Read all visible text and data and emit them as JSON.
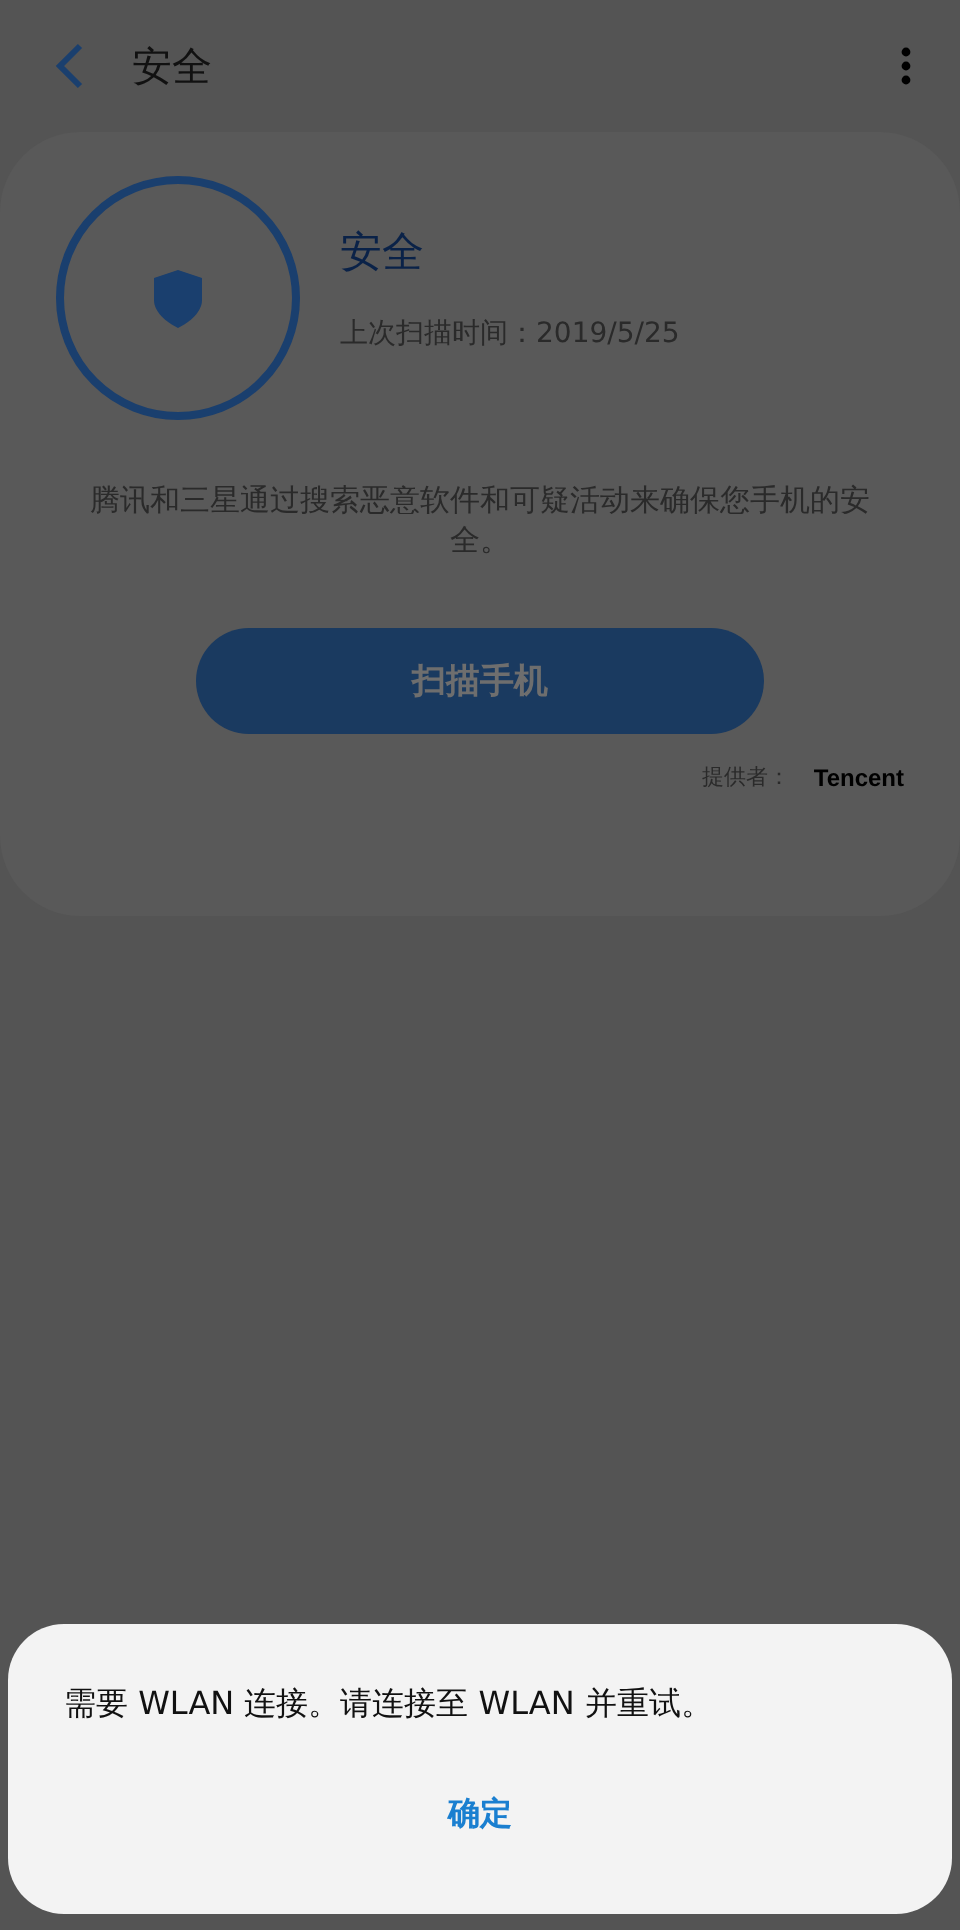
{
  "header": {
    "title": "安全"
  },
  "status": {
    "title": "安全",
    "last_scan": "上次扫描时间：2019/5/25"
  },
  "description": "腾讯和三星通过搜索恶意软件和可疑活动来确保您手机的安全。",
  "scan_button": {
    "label": "扫描手机",
    "disabled": true
  },
  "provider": {
    "label": "提供者：",
    "name": "Tencent"
  },
  "dialog": {
    "message": "需要 WLAN 连接。请连接至 WLAN 并重试。",
    "buttons": [
      "确定"
    ]
  }
}
